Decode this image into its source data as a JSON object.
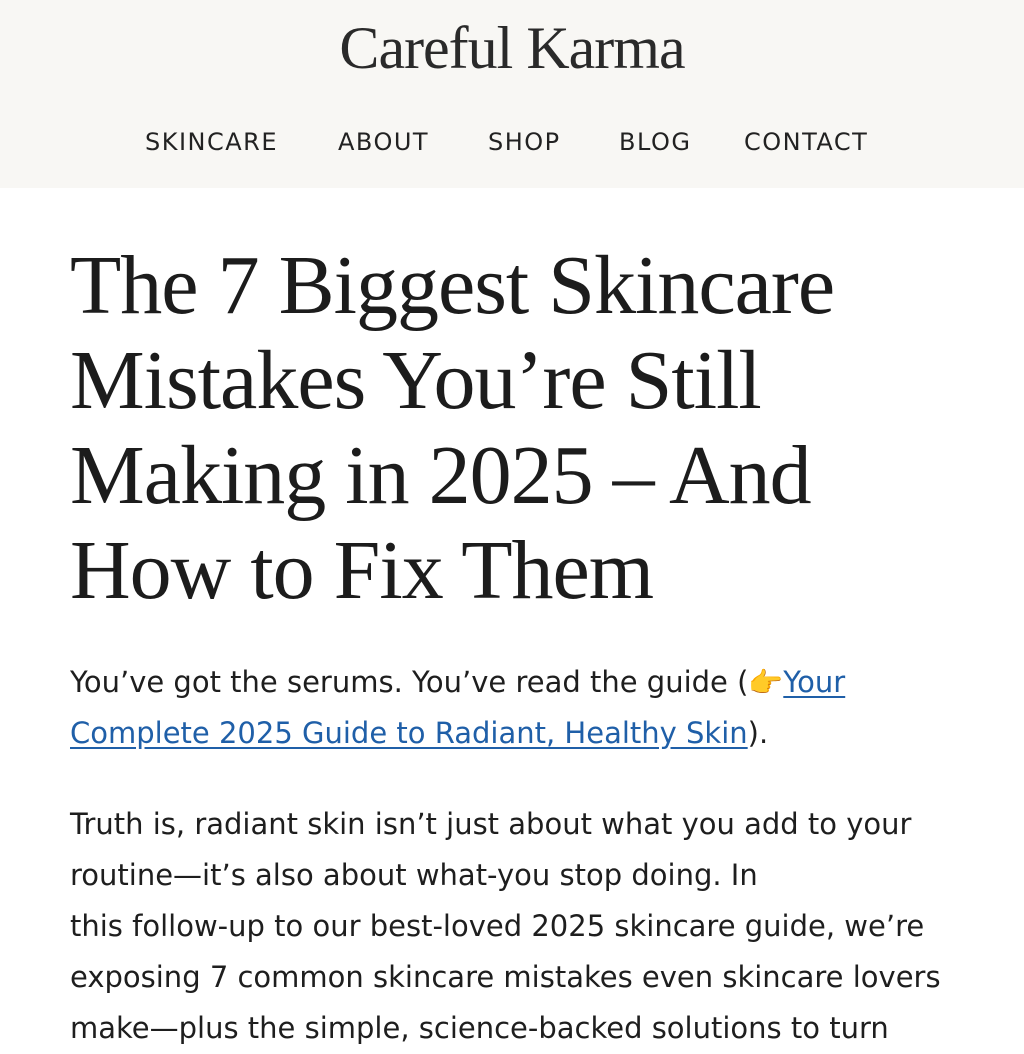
{
  "site": {
    "title": "Careful Karma"
  },
  "nav": {
    "items": [
      {
        "label": "SKINCARE"
      },
      {
        "label": "ABOUT"
      },
      {
        "label": "SHOP"
      },
      {
        "label": "BLOG"
      },
      {
        "label": "CONTACT"
      }
    ]
  },
  "article": {
    "title": "The 7 Biggest Skincare Mistakes You’re Still Making in 2025 – And How to Fix Them",
    "intro_before": "You’ve got the serums. You’ve read the guide (",
    "intro_icon": "👉",
    "intro_link": "Your Complete 2025 Guide to Radiant, Healthy Skin",
    "intro_after": ").",
    "body_line1": "Truth is, radiant skin isn’t just about what you add to your",
    "body_line2": "routine—it’s also about what-you stop doing. In",
    "body_line3": "this follow-up to our best-loved 2025 skincare  guide, we’re",
    "body_line4": "exposing 7 common skincare mistakes even skincare lovers",
    "body_line5": "make—plus the simple, science-backed solutions to turn"
  },
  "colors": {
    "header_bg": "#f8f7f4",
    "link": "#1f5fa8",
    "text": "#1c1c1c"
  },
  "icons": {
    "intro_icon_name": "pointing-hand-icon"
  }
}
